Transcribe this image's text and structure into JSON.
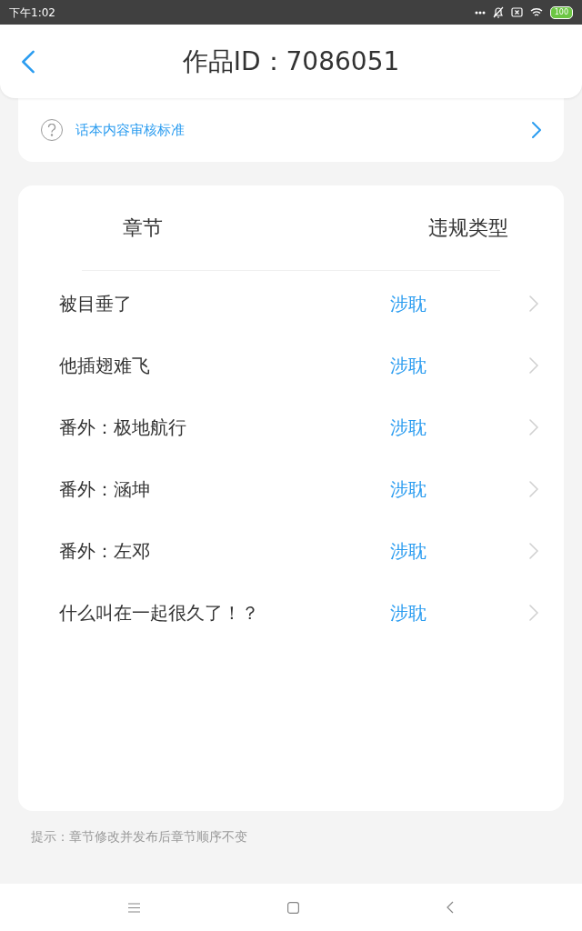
{
  "status_bar": {
    "time": "下午1:02",
    "battery": "100"
  },
  "header": {
    "title": "作品ID：7086051"
  },
  "guideline_link": {
    "label": "话本内容审核标准"
  },
  "table": {
    "columns": [
      "章节",
      "违规类型"
    ],
    "rows": [
      {
        "chapter": "被目垂了",
        "violation": "涉耽"
      },
      {
        "chapter": "他插翅难飞",
        "violation": "涉耽"
      },
      {
        "chapter": "番外：极地航行",
        "violation": "涉耽"
      },
      {
        "chapter": "番外：涵坤",
        "violation": "涉耽"
      },
      {
        "chapter": "番外：左邓",
        "violation": "涉耽"
      },
      {
        "chapter": "什么叫在一起很久了！？",
        "violation": "涉耽"
      }
    ]
  },
  "hint": "提示：章节修改并发布后章节顺序不变"
}
